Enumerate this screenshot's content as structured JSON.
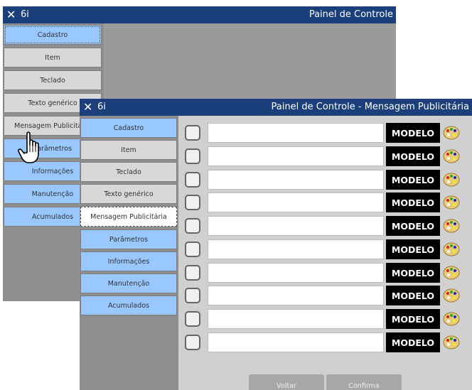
{
  "back_window": {
    "app_name": "6i",
    "title": "Painel de Controle",
    "menu": [
      {
        "label": "Cadastro",
        "style": "blue-dashed"
      },
      {
        "label": "Item",
        "style": "gray"
      },
      {
        "label": "Teclado",
        "style": "gray"
      },
      {
        "label": "Texto genérico",
        "style": "gray"
      },
      {
        "label": "Mensagem Publicitária",
        "style": "gray"
      },
      {
        "label": "Parâmetros",
        "style": "blue"
      },
      {
        "label": "Informações",
        "style": "blue"
      },
      {
        "label": "Manutenção",
        "style": "blue"
      },
      {
        "label": "Acumulados",
        "style": "blue"
      }
    ]
  },
  "front_window": {
    "app_name": "6i",
    "title": "Painel de Controle - Mensagem Publicitária",
    "menu": [
      {
        "label": "Cadastro",
        "style": "blue"
      },
      {
        "label": "Item",
        "style": "gray"
      },
      {
        "label": "Teclado",
        "style": "gray"
      },
      {
        "label": "Texto genérico",
        "style": "gray"
      },
      {
        "label": "Mensagem Publicitária",
        "style": "selected"
      },
      {
        "label": "Parâmetros",
        "style": "blue"
      },
      {
        "label": "Informações",
        "style": "blue"
      },
      {
        "label": "Manutenção",
        "style": "blue"
      },
      {
        "label": "Acumulados",
        "style": "blue"
      }
    ],
    "rows": [
      {
        "checked": false,
        "text": "",
        "model_label": "MODELO",
        "icon": "palette-icon"
      },
      {
        "checked": false,
        "text": "",
        "model_label": "MODELO",
        "icon": "palette-icon"
      },
      {
        "checked": false,
        "text": "",
        "model_label": "MODELO",
        "icon": "palette-icon"
      },
      {
        "checked": false,
        "text": "",
        "model_label": "MODELO",
        "icon": "palette-icon"
      },
      {
        "checked": false,
        "text": "",
        "model_label": "MODELO",
        "icon": "palette-icon"
      },
      {
        "checked": false,
        "text": "",
        "model_label": "MODELO",
        "icon": "palette-icon"
      },
      {
        "checked": false,
        "text": "",
        "model_label": "MODELO",
        "icon": "palette-icon"
      },
      {
        "checked": false,
        "text": "",
        "model_label": "MODELO",
        "icon": "palette-icon"
      },
      {
        "checked": false,
        "text": "",
        "model_label": "MODELO",
        "icon": "palette-icon"
      },
      {
        "checked": false,
        "text": "",
        "model_label": "MODELO",
        "icon": "palette-icon"
      }
    ],
    "buttons": {
      "back": "Voltar",
      "confirm": "Confirma"
    }
  },
  "colors": {
    "titlebar": "#1b3f7a",
    "menu_blue": "#99c7ff",
    "menu_gray": "#d8d8d8",
    "modelo_bg": "#000000"
  },
  "pointer": "hand-cursor-icon"
}
